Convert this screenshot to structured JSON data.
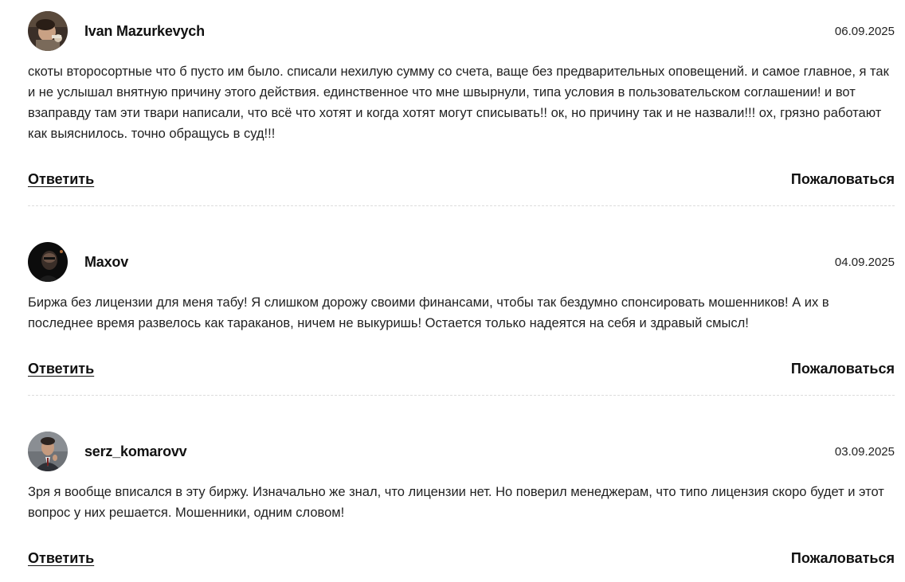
{
  "comments": [
    {
      "author": "Ivan Mazurkevych",
      "date": "06.09.2025",
      "text": "скоты второсортные что б пусто им было. списали нехилую сумму со счета, ваще без предварительных оповещений. и самое главное, я так и не услышал внятную причину этого действия. единственное что мне швырнули, типа условия в пользовательском соглашении! и вот взаправду там эти твари написали, что всё что хотят и когда хотят могут списывать!! ок, но причину так и не назвали!!! ох, грязно работают как выяснилось. точно обращусь в суд!!!",
      "reply_label": "Ответить",
      "report_label": "Пожаловаться"
    },
    {
      "author": "Maxov",
      "date": "04.09.2025",
      "text": "Биржа без лицензии для меня табу! Я слишком дорожу своими финансами, чтобы так бездумно спонсировать мошенников! А их в последнее время развелось как тараканов, ничем не выкуришь! Остается только надеятся на себя и здравый смысл!",
      "reply_label": "Ответить",
      "report_label": "Пожаловаться"
    },
    {
      "author": "serz_komarovv",
      "date": "03.09.2025",
      "text": "Зря я вообще вписался в эту биржу. Изначально же знал, что лицензии нет. Но поверил менеджерам, что типо лицензия скоро будет и этот вопрос у них решается. Мошенники, одним словом!",
      "reply_label": "Ответить",
      "report_label": "Пожаловаться"
    }
  ],
  "colors": {
    "text": "#222222",
    "divider": "#dcdcdc"
  },
  "icons": [
    "avatar-photo-1",
    "avatar-photo-2",
    "avatar-photo-3"
  ]
}
